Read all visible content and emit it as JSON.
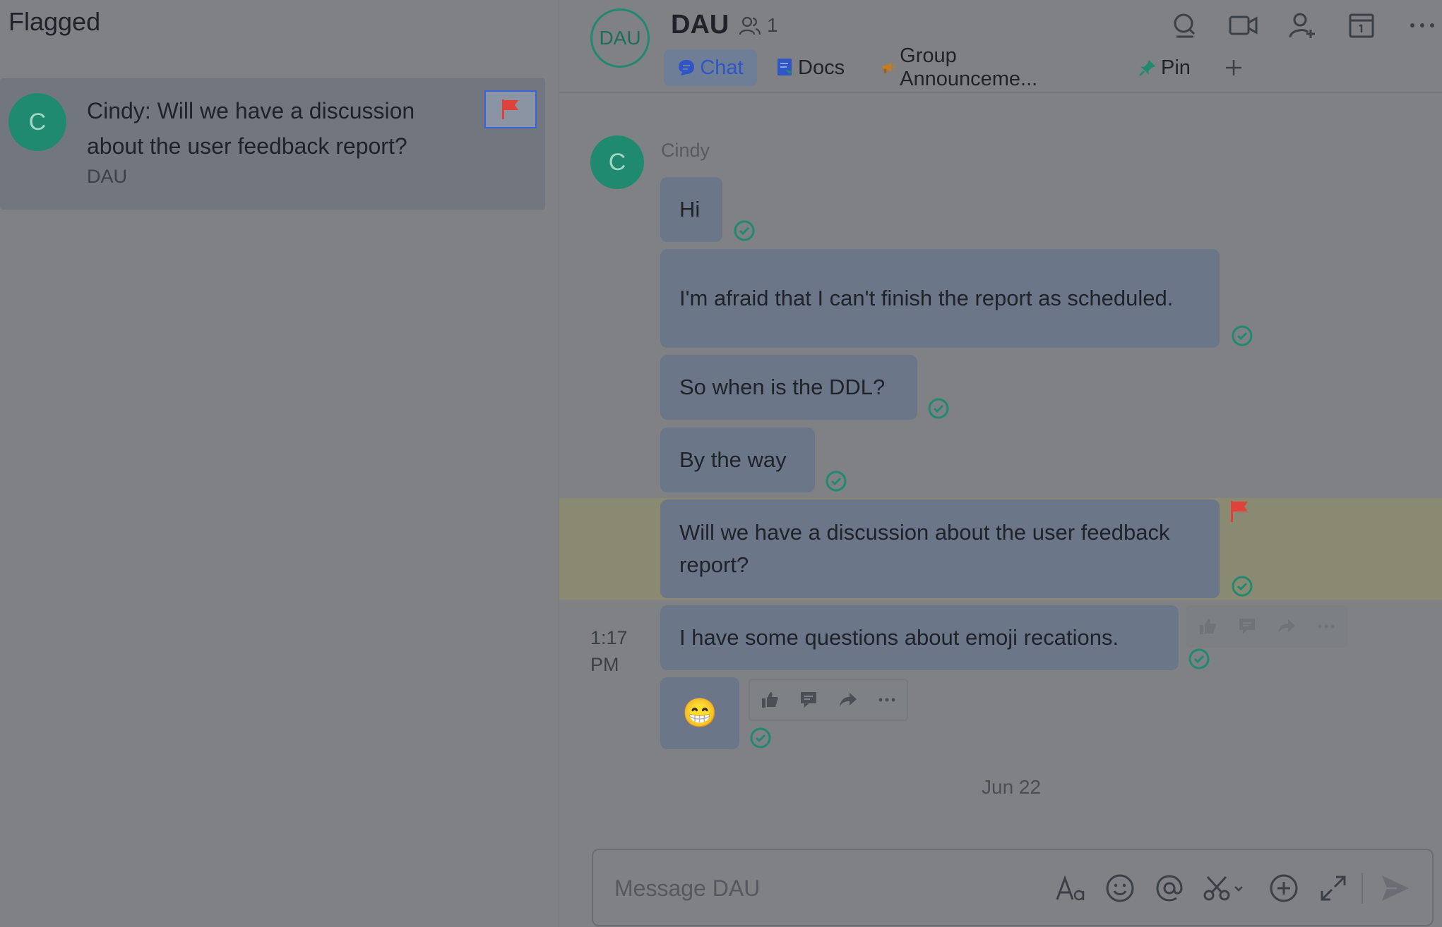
{
  "left_panel": {
    "title": "Flagged",
    "flagged_item": {
      "avatar_letter": "C",
      "text": "Cindy: Will we have a discussion about the user feedback report?",
      "chat_name": "DAU"
    }
  },
  "header": {
    "avatar_text": "DAU",
    "title": "DAU",
    "member_count": "1",
    "tabs": [
      {
        "label": "Chat",
        "icon": "chat-bubble-icon"
      },
      {
        "label": "Docs",
        "icon": "doc-icon"
      },
      {
        "label": "Group Announceme...",
        "icon": "megaphone-icon"
      },
      {
        "label": "Pin",
        "icon": "pin-icon"
      }
    ],
    "actions": [
      "search-icon",
      "video-icon",
      "add-member-icon",
      "calendar-icon",
      "more-icon"
    ]
  },
  "messages": {
    "sender": "Cindy",
    "avatar_letter": "C",
    "items": [
      {
        "text": "Hi"
      },
      {
        "text": "I'm afraid that I can't finish the report as scheduled."
      },
      {
        "text": "So when is the DDL?"
      },
      {
        "text": "By the way"
      },
      {
        "text": "Will we have a discussion about the user feedback report?",
        "flagged": true
      },
      {
        "text": "I have some questions about emoji recations."
      },
      {
        "text": "😁"
      }
    ],
    "time_label_line1": "1:17",
    "time_label_line2": "PM",
    "date_separator": "Jun 22"
  },
  "composer": {
    "placeholder": "Message DAU",
    "value": "",
    "tools": [
      "text-format-icon",
      "emoji-icon",
      "mention-icon",
      "screenshot-icon",
      "add-icon",
      "expand-icon",
      "send-icon"
    ]
  },
  "colors": {
    "accent": "#2f55c6",
    "avatar_green": "#1f8a70",
    "flag_red": "#e0413b",
    "read_check": "#1f8a70",
    "highlight": "#8a8a73"
  }
}
